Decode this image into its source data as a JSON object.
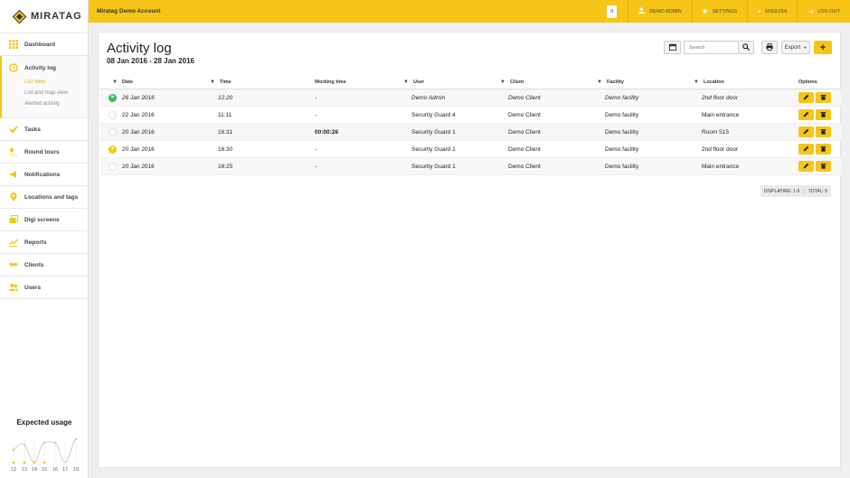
{
  "brand": {
    "name": "MIRATAG"
  },
  "topbar": {
    "account": "Miratag Demo Account",
    "notif_count": "0",
    "user": "DEMO ADMIN",
    "settings": "SETTINGS",
    "language": "ENGLISH",
    "logout": "LOG OUT"
  },
  "sidebar": {
    "items": [
      {
        "label": "Dashboard",
        "icon": "grid-icon"
      },
      {
        "label": "Activity log",
        "icon": "clock-icon"
      },
      {
        "label": "Tasks",
        "icon": "check-icon"
      },
      {
        "label": "Round tours",
        "icon": "route-icon"
      },
      {
        "label": "Notifications",
        "icon": "megaphone-icon"
      },
      {
        "label": "Locations and tags",
        "icon": "pin-icon"
      },
      {
        "label": "Digi screens",
        "icon": "screens-icon"
      },
      {
        "label": "Reports",
        "icon": "chart-icon"
      },
      {
        "label": "Clients",
        "icon": "handshake-icon"
      },
      {
        "label": "Users",
        "icon": "users-icon"
      }
    ],
    "subitems": [
      "List view",
      "List and map view",
      "Alerted activity"
    ],
    "usage": {
      "title": "Expected usage",
      "x_labels": [
        "12",
        "13",
        "14",
        "15",
        "16",
        "17",
        "18"
      ]
    }
  },
  "page": {
    "title": "Activity log",
    "date_range": "08 Jan 2016 - 28 Jan 2016",
    "search_placeholder": "Search",
    "export_label": "Export"
  },
  "table": {
    "columns": [
      "Date",
      "Time",
      "Working time",
      "User",
      "Client",
      "Facility",
      "Location",
      "Options"
    ],
    "rows": [
      {
        "status": "flag-green",
        "italic": true,
        "date": "26 Jan 2016",
        "time": "12:20",
        "work": "-",
        "user": "Demo Admin",
        "client": "Demo Client",
        "facility": "Demo facility",
        "location": "2nd floor door"
      },
      {
        "status": "empty",
        "italic": false,
        "date": "22 Jan 2016",
        "time": "11:11",
        "work": "-",
        "user": "Security Guard 4",
        "client": "Demo Client",
        "facility": "Demo facility",
        "location": "Main entrance"
      },
      {
        "status": "empty",
        "italic": false,
        "date": "20 Jan 2016",
        "time": "16:31",
        "work": "00:00:28",
        "user": "Security Guard 1",
        "client": "Demo Client",
        "facility": "Demo facility",
        "location": "Room 515"
      },
      {
        "status": "flag-yellow",
        "italic": false,
        "date": "20 Jan 2016",
        "time": "16:30",
        "work": "-",
        "user": "Security Guard 1",
        "client": "Demo Client",
        "facility": "Demo facility",
        "location": "2nd floor door"
      },
      {
        "status": "empty",
        "italic": false,
        "date": "20 Jan 2016",
        "time": "16:25",
        "work": "-",
        "user": "Security Guard 1",
        "client": "Demo Client",
        "facility": "Demo facility",
        "location": "Main entrance"
      }
    ]
  },
  "pager": {
    "displaying": "DISPLAYING: 1-5",
    "total": "TOTAL: 5"
  },
  "colors": {
    "accent": "#f5c518",
    "flag_green": "#33c24d"
  }
}
